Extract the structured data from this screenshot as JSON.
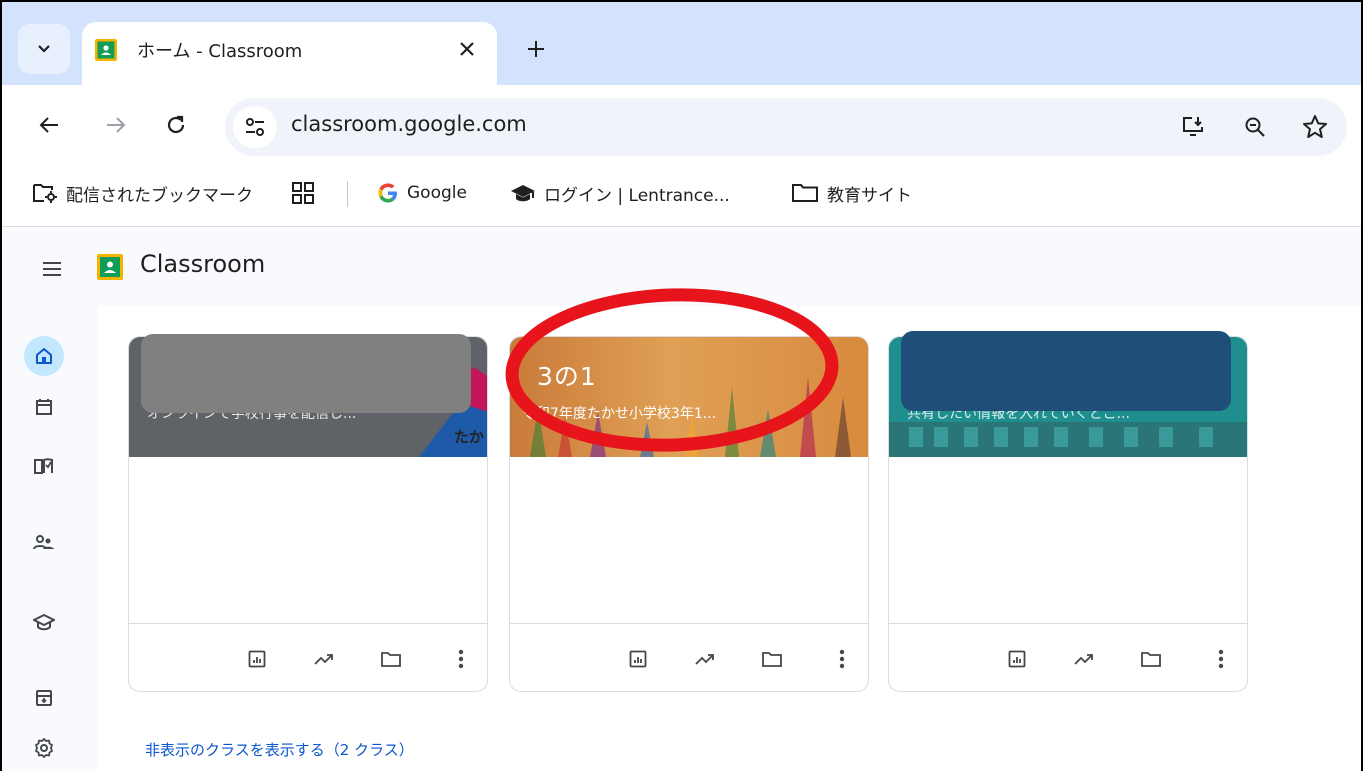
{
  "browser": {
    "tab_title": "ホーム - Classroom",
    "url": "classroom.google.com",
    "bookmarks": {
      "managed": "配信されたブックマーク",
      "google": "Google",
      "login": "ログイン | Lentrance...",
      "folder": "教育サイト"
    }
  },
  "app": {
    "title": "Classroom"
  },
  "classes": [
    {
      "name": "",
      "subtitle": "オンラインで学校行事を配信し...",
      "banner_color": "#5f6368"
    },
    {
      "name": "3の1",
      "subtitle": "令和7年度たかせ小学校3年1...",
      "banner_color": "#d98a3c"
    },
    {
      "name": "",
      "subtitle": "共有したい情報を入れていくとこ...",
      "banner_color": "#1e8e8e"
    }
  ],
  "footer": {
    "show_hidden": "非表示のクラスを表示する（2 クラス）"
  },
  "colors": {
    "annotation": "#e8141c",
    "accent": "#0b57d0",
    "redaction_gray": "#808080",
    "redaction_blue": "#1f4e79"
  }
}
